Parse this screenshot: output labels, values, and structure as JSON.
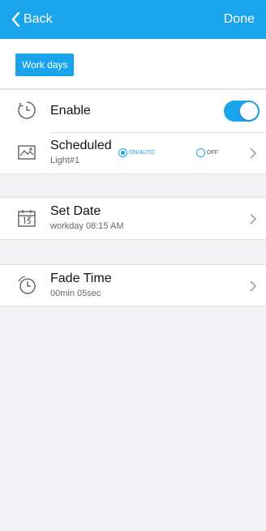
{
  "nav": {
    "back_label": "Back",
    "done_label": "Done"
  },
  "chip": {
    "label": "Work days"
  },
  "enable": {
    "label": "Enable",
    "on": true
  },
  "scheduled": {
    "title": "Scheduled",
    "subtitle": "Light#1",
    "options": [
      {
        "label": "ON/AUTO",
        "selected": true
      },
      {
        "label": "OFF",
        "selected": false
      }
    ]
  },
  "set_date": {
    "title": "Set Date",
    "subtitle": "workday 08:15 AM"
  },
  "fade_time": {
    "title": "Fade Time",
    "subtitle": "00min 05sec"
  },
  "colors": {
    "accent": "#1aa4ec",
    "background": "#f2f2f4"
  }
}
